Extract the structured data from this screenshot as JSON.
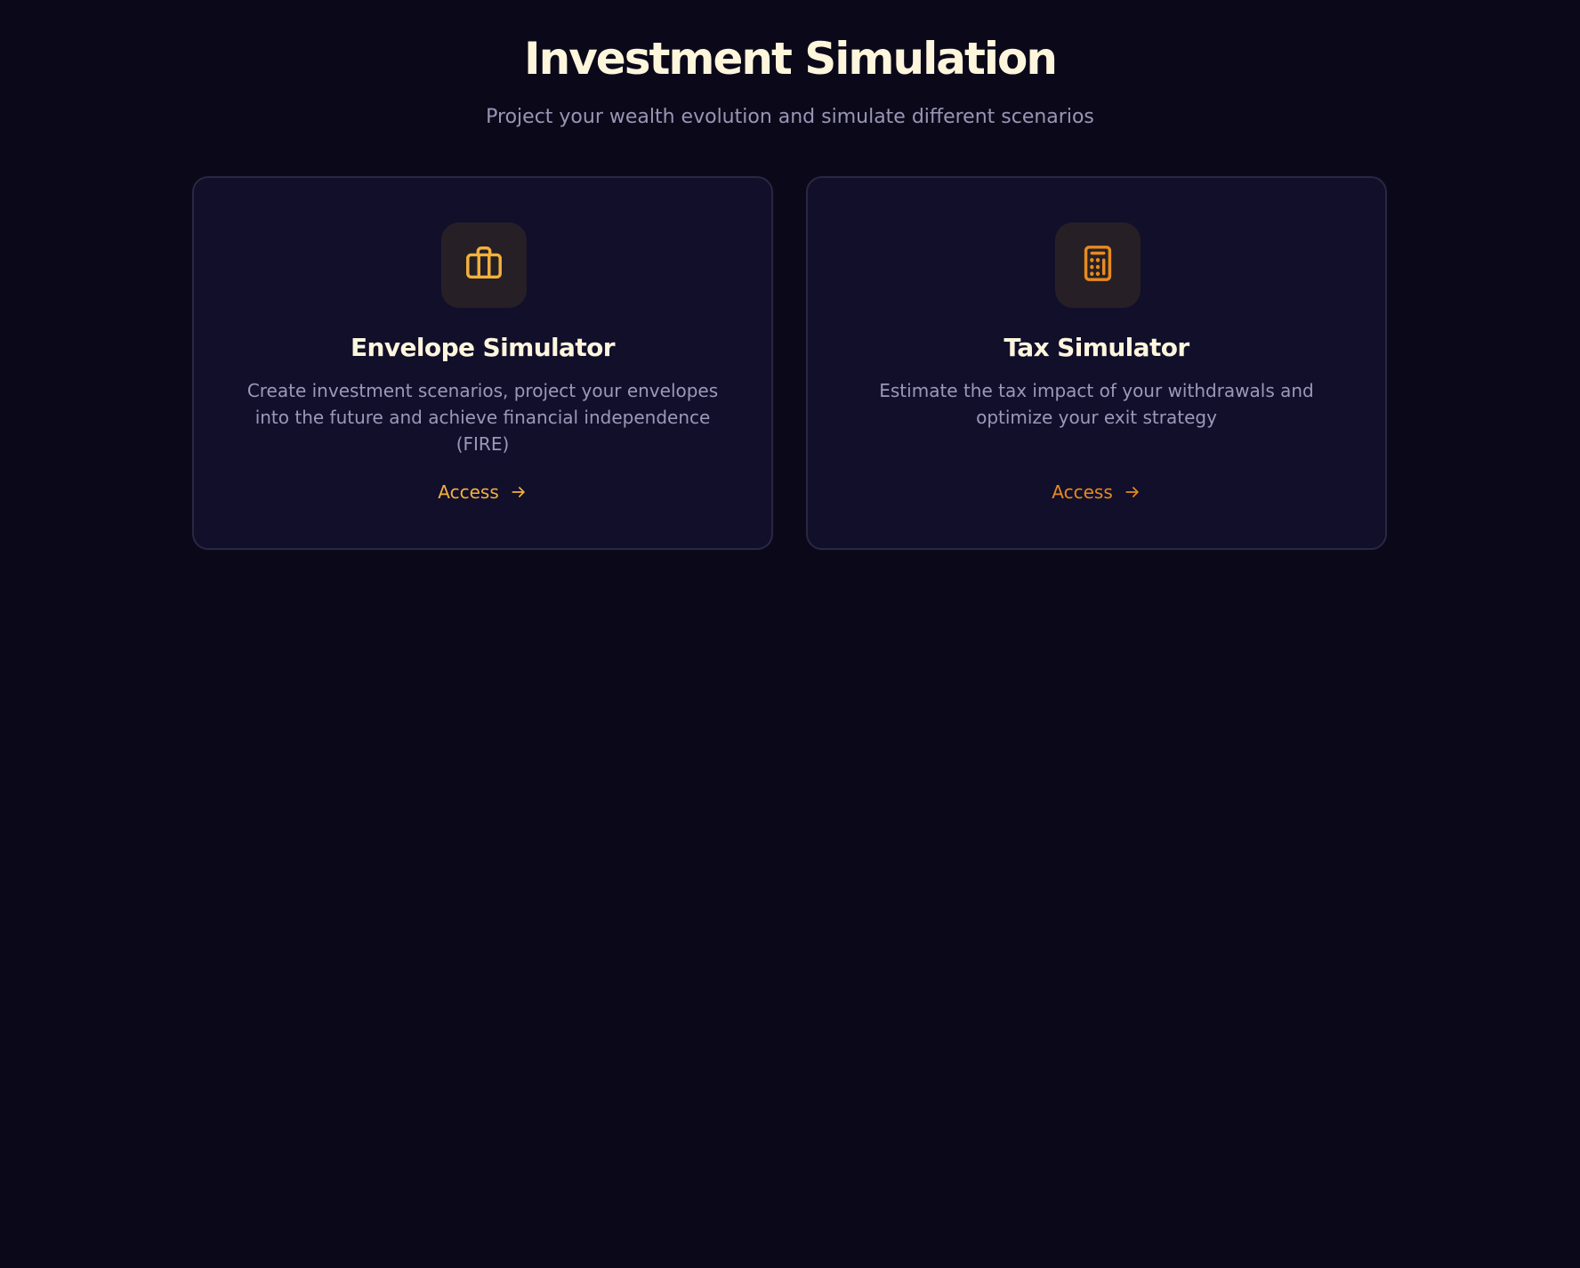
{
  "header": {
    "title": "Investment Simulation",
    "subtitle": "Project your wealth evolution and simulate different scenarios"
  },
  "cards": [
    {
      "icon": "briefcase-icon",
      "title": "Envelope Simulator",
      "description": "Create investment scenarios, project your envelopes into the future and achieve financial independence (FIRE)",
      "link_label": "Access",
      "accent_color": "#f2b13c"
    },
    {
      "icon": "calculator-icon",
      "title": "Tax Simulator",
      "description": "Estimate the tax impact of your withdrawals and optimize your exit strategy",
      "link_label": "Access",
      "accent_color": "#e88a1f"
    }
  ],
  "colors": {
    "background": "#0b0919",
    "card_background": "#120f2b",
    "card_border": "#2a2742",
    "title_text": "#fdf6dc",
    "muted_text": "#9c98b8"
  }
}
